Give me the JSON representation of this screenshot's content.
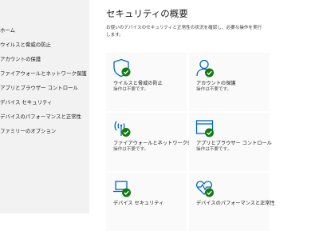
{
  "sidebar": {
    "items": [
      {
        "label": "ホーム"
      },
      {
        "label": "ウイルスと脅威の防止"
      },
      {
        "label": "アカウントの保護"
      },
      {
        "label": "ファイアウォールとネットワーク保護"
      },
      {
        "label": "アプリとブラウザー コントロール"
      },
      {
        "label": "デバイス セキュリティ"
      },
      {
        "label": "デバイスのパフォーマンスと正常性"
      },
      {
        "label": "ファミリーのオプション"
      }
    ]
  },
  "main": {
    "title": "セキュリティの概要",
    "description": "お使いのデバイスのセキュリティと正常性の状況を確認し、必要な操作を実行します。",
    "tiles": [
      {
        "title": "ウイルスと脅威の防止",
        "status": "操作は不要です。",
        "icon": "shield-icon"
      },
      {
        "title": "アカウントの保護",
        "status": "操作は不要です。",
        "icon": "person-icon"
      },
      {
        "title": "ファイアウォールとネットワーク保護",
        "status": "操作は不要です。",
        "icon": "wifi-antenna-icon"
      },
      {
        "title": "アプリとブラウザー コントロール",
        "status": "操作は不要です。",
        "icon": "browser-window-icon"
      },
      {
        "title": "デバイス セキュリティ",
        "status": "",
        "icon": "laptop-icon"
      },
      {
        "title": "デバイスのパフォーマンスと正常性",
        "status": "",
        "icon": "heart-pulse-icon"
      }
    ]
  },
  "colors": {
    "accent": "#0067c0",
    "ok_badge": "#107c10"
  }
}
